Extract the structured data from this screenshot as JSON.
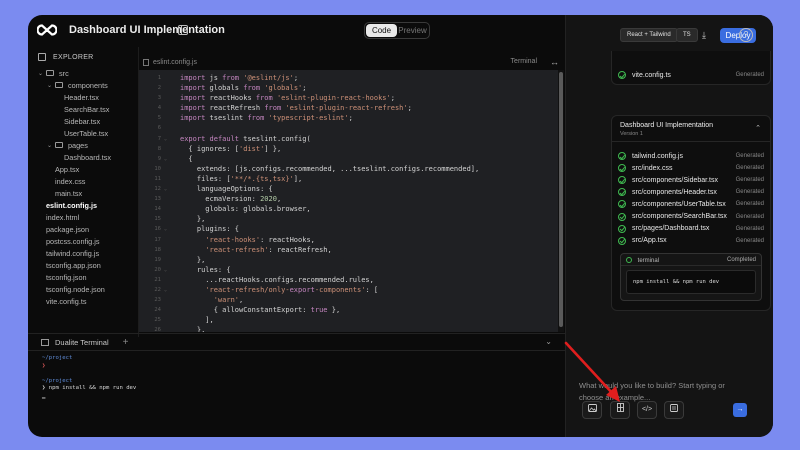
{
  "window": {
    "project_title": "Dashboard UI Implementation",
    "view_toggle": {
      "code_label": "Code",
      "preview_label": "Preview",
      "active": "code"
    }
  },
  "explorer": {
    "title": "EXPLORER",
    "items": [
      {
        "label": "src",
        "type": "folder",
        "depth": 0
      },
      {
        "label": "components",
        "type": "folder",
        "depth": 1
      },
      {
        "label": "Header.tsx",
        "type": "file",
        "depth": 2
      },
      {
        "label": "SearchBar.tsx",
        "type": "file",
        "depth": 2
      },
      {
        "label": "Sidebar.tsx",
        "type": "file",
        "depth": 2
      },
      {
        "label": "UserTable.tsx",
        "type": "file",
        "depth": 2
      },
      {
        "label": "pages",
        "type": "folder",
        "depth": 1
      },
      {
        "label": "Dashboard.tsx",
        "type": "file",
        "depth": 2
      },
      {
        "label": "App.tsx",
        "type": "file",
        "depth": 1
      },
      {
        "label": "index.css",
        "type": "file",
        "depth": 1
      },
      {
        "label": "main.tsx",
        "type": "file",
        "depth": 1
      },
      {
        "label": "eslint.config.js",
        "type": "file",
        "depth": 0,
        "selected": true
      },
      {
        "label": "index.html",
        "type": "file",
        "depth": 0
      },
      {
        "label": "package.json",
        "type": "file",
        "depth": 0
      },
      {
        "label": "postcss.config.js",
        "type": "file",
        "depth": 0
      },
      {
        "label": "tailwind.config.js",
        "type": "file",
        "depth": 0
      },
      {
        "label": "tsconfig.app.json",
        "type": "file",
        "depth": 0
      },
      {
        "label": "tsconfig.json",
        "type": "file",
        "depth": 0
      },
      {
        "label": "tsconfig.node.json",
        "type": "file",
        "depth": 0
      },
      {
        "label": "vite.config.ts",
        "type": "file",
        "depth": 0
      }
    ]
  },
  "editor": {
    "filename": "eslint.config.js",
    "terminal_link": "Terminal",
    "lines": [
      {
        "n": "1",
        "fold": "",
        "code": "import js from '@eslint/js';"
      },
      {
        "n": "2",
        "fold": "",
        "code": "import globals from 'globals';"
      },
      {
        "n": "3",
        "fold": "",
        "code": "import reactHooks from 'eslint-plugin-react-hooks';"
      },
      {
        "n": "4",
        "fold": "",
        "code": "import reactRefresh from 'eslint-plugin-react-refresh';"
      },
      {
        "n": "5",
        "fold": "",
        "code": "import tseslint from 'typescript-eslint';"
      },
      {
        "n": "6",
        "fold": "",
        "code": ""
      },
      {
        "n": "7",
        "fold": "⌄",
        "code": "export default tseslint.config("
      },
      {
        "n": "8",
        "fold": "",
        "code": "  { ignores: ['dist'] },"
      },
      {
        "n": "9",
        "fold": "⌄",
        "code": "  {"
      },
      {
        "n": "10",
        "fold": "",
        "code": "    extends: [js.configs.recommended, ...tseslint.configs.recommended],"
      },
      {
        "n": "11",
        "fold": "",
        "code": "    files: ['**/*.{ts,tsx}'],"
      },
      {
        "n": "12",
        "fold": "⌄",
        "code": "    languageOptions: {"
      },
      {
        "n": "13",
        "fold": "",
        "code": "      ecmaVersion: 2020,"
      },
      {
        "n": "14",
        "fold": "",
        "code": "      globals: globals.browser,"
      },
      {
        "n": "15",
        "fold": "",
        "code": "    },"
      },
      {
        "n": "16",
        "fold": "⌄",
        "code": "    plugins: {"
      },
      {
        "n": "17",
        "fold": "",
        "code": "      'react-hooks': reactHooks,"
      },
      {
        "n": "18",
        "fold": "",
        "code": "      'react-refresh': reactRefresh,"
      },
      {
        "n": "19",
        "fold": "",
        "code": "    },"
      },
      {
        "n": "20",
        "fold": "⌄",
        "code": "    rules: {"
      },
      {
        "n": "21",
        "fold": "",
        "code": "      ...reactHooks.configs.recommended.rules,"
      },
      {
        "n": "22",
        "fold": "⌄",
        "code": "      'react-refresh/only-export-components': ["
      },
      {
        "n": "23",
        "fold": "",
        "code": "        'warn',"
      },
      {
        "n": "24",
        "fold": "",
        "code": "        { allowConstantExport: true },"
      },
      {
        "n": "25",
        "fold": "",
        "code": "      ],"
      },
      {
        "n": "26",
        "fold": "",
        "code": "    },"
      }
    ]
  },
  "terminal": {
    "title": "Dualite Terminal",
    "lines": [
      {
        "kind": "path",
        "text": "~/project"
      },
      {
        "kind": "prompt",
        "text": "❯"
      },
      {
        "kind": "blank",
        "text": ""
      },
      {
        "kind": "path",
        "text": "~/project"
      },
      {
        "kind": "cmd",
        "text": "❯ npm install && npm run dev"
      },
      {
        "kind": "cmd",
        "text": "▁"
      }
    ]
  },
  "topright": {
    "stack_badge": "React + Tailwind",
    "lang_badge": "TS",
    "deploy_label": "Deploy",
    "help_label": "?"
  },
  "prev_card": {
    "file": "vite.config.ts",
    "status": "Generated"
  },
  "version_card": {
    "title": "Dashboard UI Implementation",
    "version": "Version 1",
    "files": [
      {
        "name": "tailwind.config.js",
        "status": "Generated"
      },
      {
        "name": "src/index.css",
        "status": "Generated"
      },
      {
        "name": "src/components/Sidebar.tsx",
        "status": "Generated"
      },
      {
        "name": "src/components/Header.tsx",
        "status": "Generated"
      },
      {
        "name": "src/components/UserTable.tsx",
        "status": "Generated"
      },
      {
        "name": "src/components/SearchBar.tsx",
        "status": "Generated"
      },
      {
        "name": "src/pages/Dashboard.tsx",
        "status": "Generated"
      },
      {
        "name": "src/App.tsx",
        "status": "Generated"
      }
    ],
    "terminal": {
      "label": "terminal",
      "status": "Completed",
      "command": "npm install && npm run dev"
    }
  },
  "prompt": {
    "placeholder": "What would you like to build? Start typing or choose an example..."
  },
  "tools": {
    "image_icon": "image-icon",
    "figma_icon": "figma-icon",
    "code_icon": "code-icon",
    "doc_icon": "document-icon",
    "send_icon": "arrow-right-icon"
  },
  "colors": {
    "background": "#7b8bf0",
    "accent": "#3a6de0",
    "success": "#3fb950",
    "annotation_arrow": "#e01e1e"
  }
}
